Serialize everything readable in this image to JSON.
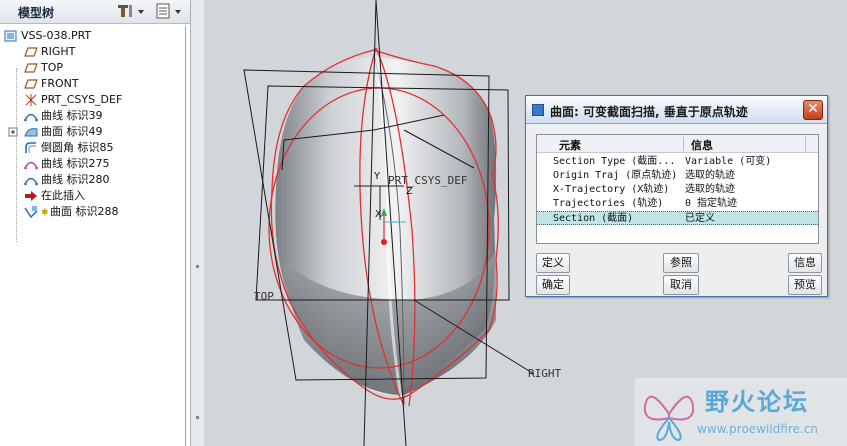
{
  "model_tree": {
    "title": "模型树",
    "items": [
      {
        "label": "VSS-038.PRT",
        "icon": "part-icon"
      },
      {
        "label": "RIGHT",
        "icon": "datum-plane-icon"
      },
      {
        "label": "TOP",
        "icon": "datum-plane-icon"
      },
      {
        "label": "FRONT",
        "icon": "datum-plane-icon"
      },
      {
        "label": "PRT_CSYS_DEF",
        "icon": "csys-icon"
      },
      {
        "label": "曲线 标识39",
        "icon": "curve-icon"
      },
      {
        "label": "曲面 标识49",
        "icon": "surface-icon"
      },
      {
        "label": "倒圆角 标识85",
        "icon": "round-icon"
      },
      {
        "label": "曲线 标识275",
        "icon": "curve-icon"
      },
      {
        "label": "曲线 标识280",
        "icon": "curve-icon"
      },
      {
        "label": "在此插入",
        "icon": "insert-arrow-icon"
      },
      {
        "label": "曲面 标识288",
        "icon": "sweep-surface-icon"
      }
    ]
  },
  "viewport": {
    "csys_label": "PRT_CSYS_DEF",
    "plane_top_label": "TOP",
    "plane_right_label": "RIGHT",
    "axis_y": "Y",
    "axis_z": "Z",
    "axis_x": "X"
  },
  "dialog": {
    "title": "曲面: 可变截面扫描, 垂直于原点轨迹",
    "close": "✕",
    "col_element": "元素",
    "col_info": "信息",
    "rows": [
      {
        "element": "Section Type (截面...",
        "info": "Variable (可变)"
      },
      {
        "element": "Origin Traj (原点轨迹)",
        "info": "选取的轨迹"
      },
      {
        "element": "X-Trajectory (X轨迹)",
        "info": "选取的轨迹"
      },
      {
        "element": "Trajectories (轨迹)",
        "info": "0 指定轨迹"
      },
      {
        "element": "Section (截面)",
        "info": "已定义"
      }
    ],
    "buttons": {
      "define": "定义",
      "refs": "参照",
      "info": "信息",
      "ok": "确定",
      "cancel": "取消",
      "preview": "预览"
    }
  },
  "watermark": {
    "text": "野火论坛",
    "url": "www.proewildfire.cn"
  }
}
